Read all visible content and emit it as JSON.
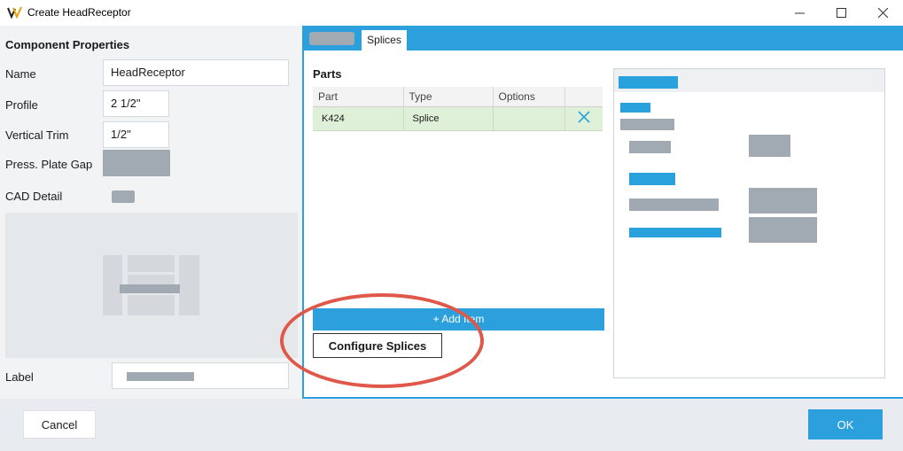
{
  "window": {
    "title": "Create HeadReceptor"
  },
  "properties": {
    "heading": "Component Properties",
    "name_label": "Name",
    "name_value": "HeadReceptor",
    "profile_label": "Profile",
    "profile_value": "2 1/2\"",
    "vertical_trim_label": "Vertical Trim",
    "vertical_trim_value": "1/2\"",
    "press_plate_gap_label": "Press. Plate Gap",
    "cad_detail_label": "CAD Detail",
    "label_label": "Label"
  },
  "tabs": {
    "active": "Splices"
  },
  "parts": {
    "heading": "Parts",
    "columns": [
      "Part",
      "Type",
      "Options"
    ],
    "rows": [
      {
        "part": "K424",
        "type": "Splice",
        "options": ""
      }
    ],
    "add_item_label": "+ Add Item",
    "configure_label": "Configure Splices"
  },
  "footer": {
    "cancel_label": "Cancel",
    "ok_label": "OK"
  },
  "colors": {
    "accent": "#2ba0dd",
    "annotation": "#e0584a",
    "row_highlight": "#dff0d8"
  }
}
